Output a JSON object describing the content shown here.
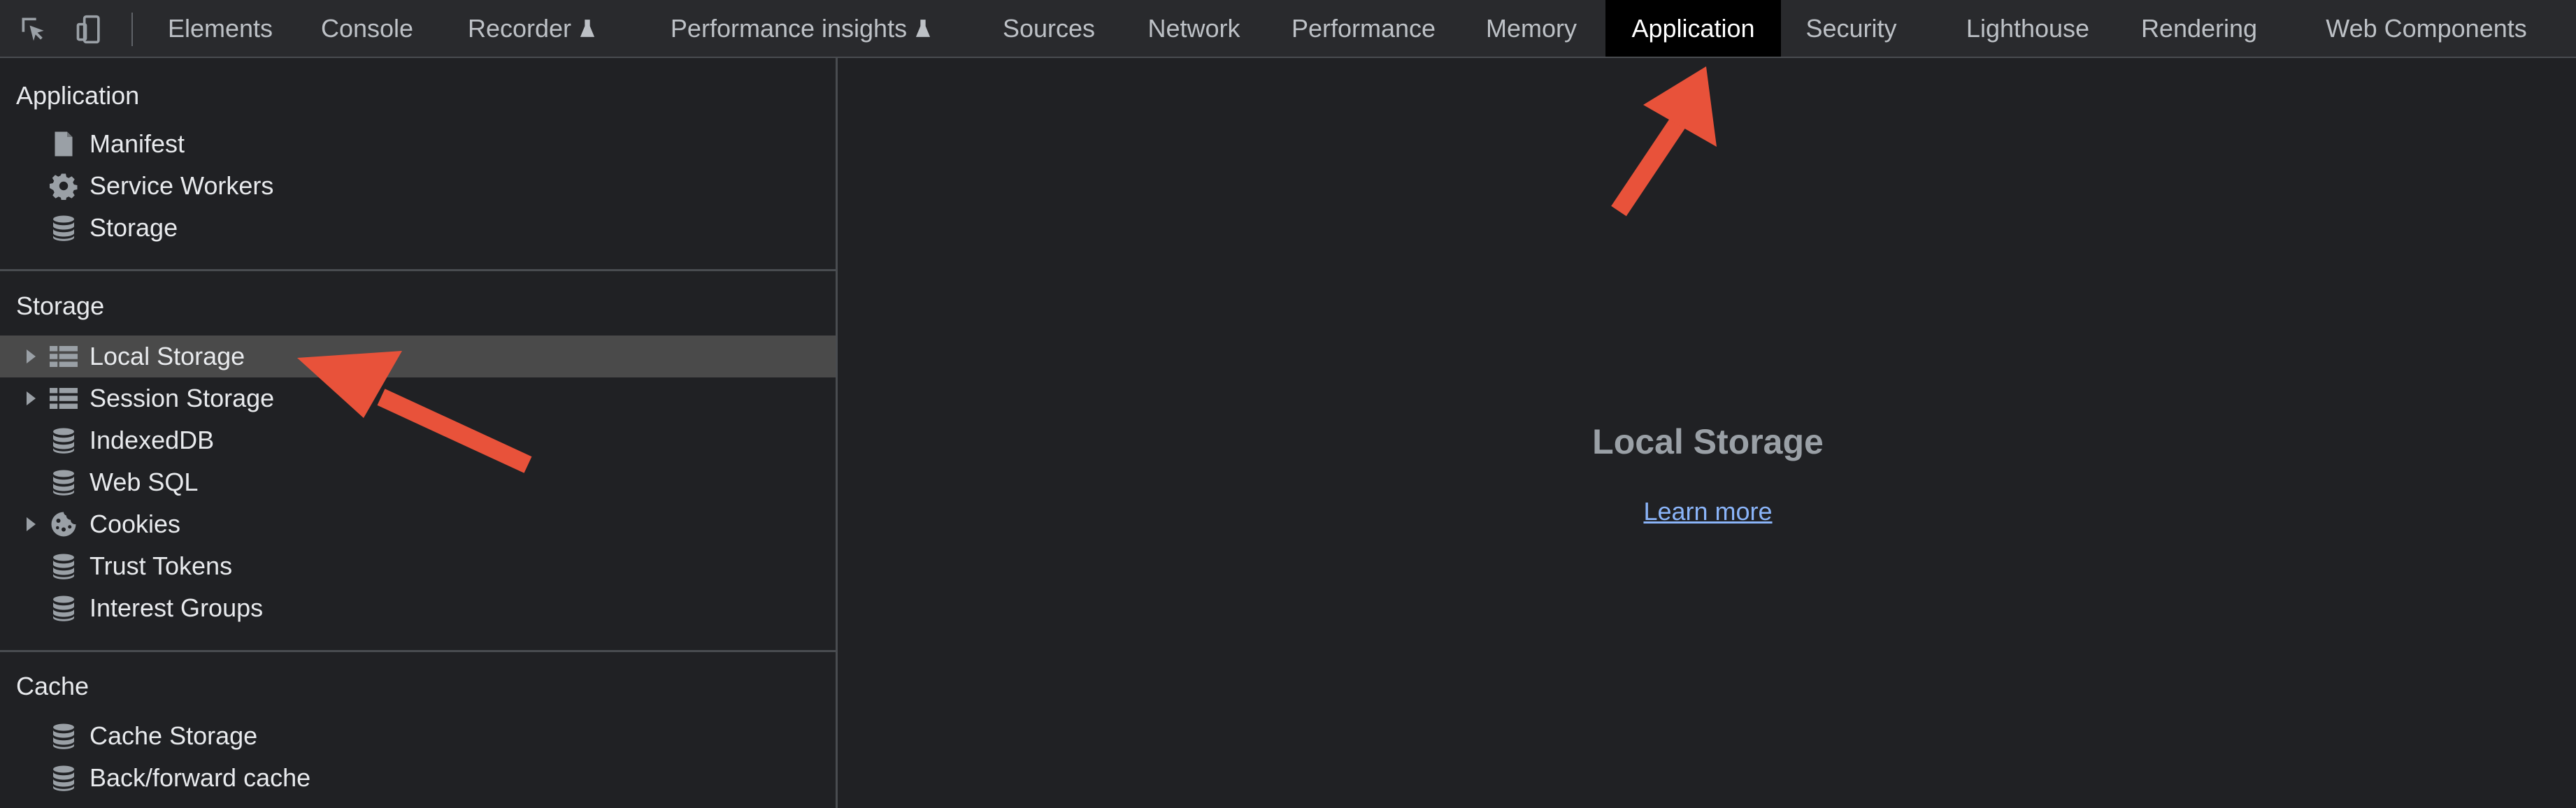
{
  "toolbar": {
    "tabs": [
      {
        "label": "Elements"
      },
      {
        "label": "Console"
      },
      {
        "label": "Recorder"
      },
      {
        "label": "Performance insights"
      },
      {
        "label": "Sources"
      },
      {
        "label": "Network"
      },
      {
        "label": "Performance"
      },
      {
        "label": "Memory"
      },
      {
        "label": "Application"
      },
      {
        "label": "Security"
      },
      {
        "label": "Lighthouse"
      },
      {
        "label": "Rendering"
      },
      {
        "label": "Web Components"
      }
    ],
    "active_tab": "Application",
    "experimental_icon": "flask-icon",
    "left_icons": [
      "inspect-element-icon",
      "device-toolbar-icon"
    ]
  },
  "sidebar": {
    "sections": [
      {
        "title": "Application",
        "items": [
          {
            "label": "Manifest",
            "icon": "file-icon",
            "expandable": false
          },
          {
            "label": "Service Workers",
            "icon": "gear-icon",
            "expandable": false
          },
          {
            "label": "Storage",
            "icon": "database-icon",
            "expandable": false
          }
        ]
      },
      {
        "title": "Storage",
        "items": [
          {
            "label": "Local Storage",
            "icon": "grid-icon",
            "expandable": true,
            "selected": true
          },
          {
            "label": "Session Storage",
            "icon": "grid-icon",
            "expandable": true
          },
          {
            "label": "IndexedDB",
            "icon": "database-icon",
            "expandable": false
          },
          {
            "label": "Web SQL",
            "icon": "database-icon",
            "expandable": false
          },
          {
            "label": "Cookies",
            "icon": "cookie-icon",
            "expandable": true
          },
          {
            "label": "Trust Tokens",
            "icon": "database-icon",
            "expandable": false
          },
          {
            "label": "Interest Groups",
            "icon": "database-icon",
            "expandable": false
          }
        ]
      },
      {
        "title": "Cache",
        "items": [
          {
            "label": "Cache Storage",
            "icon": "database-icon",
            "expandable": false
          },
          {
            "label": "Back/forward cache",
            "icon": "database-icon",
            "expandable": false
          }
        ]
      }
    ]
  },
  "main": {
    "title": "Local Storage",
    "link": "Learn more"
  },
  "colors": {
    "background": "#202124",
    "toolbar": "#292a2d",
    "active_tab": "#000000",
    "selected_row": "#4a4a4a",
    "link": "#8ab4f8",
    "annotation_arrow": "#e8523a"
  }
}
